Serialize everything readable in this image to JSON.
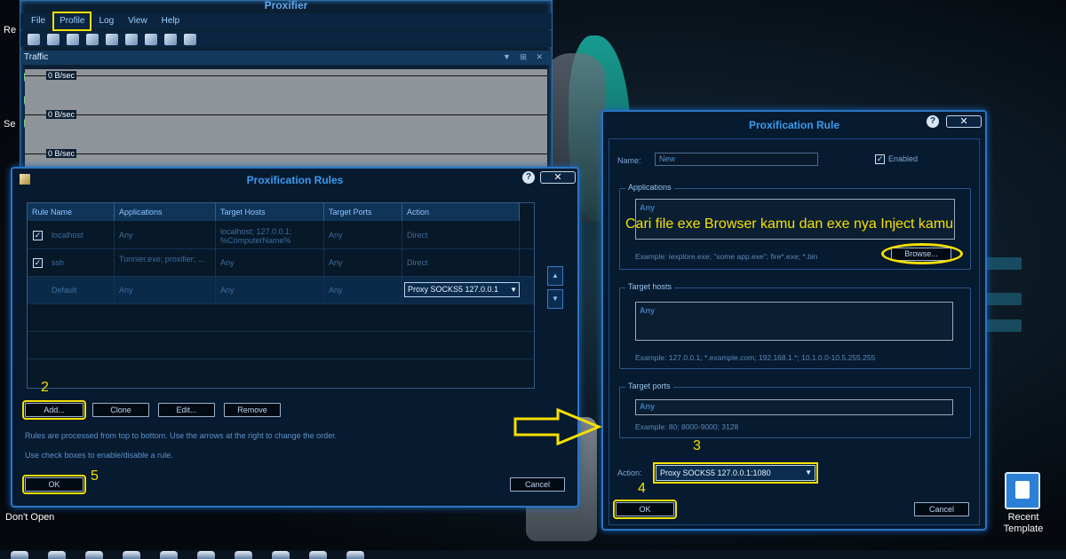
{
  "desktop": {
    "left_label_1": "Re",
    "left_label_2": "Se",
    "bottom_label": "Don't Open",
    "recent_template_line1": "Recent",
    "recent_template_line2": "Template"
  },
  "main_window": {
    "title": "Proxifier",
    "menu": [
      "File",
      "Profile",
      "Log",
      "View",
      "Help"
    ],
    "panel_title": "Traffic",
    "traffic_labels": [
      "0 B/sec",
      "0 B/sec",
      "0 B/sec"
    ]
  },
  "rules_dialog": {
    "title": "Proxification Rules",
    "help": "?",
    "close": "✕",
    "columns": [
      "Rule Name",
      "Applications",
      "Target Hosts",
      "Target Ports",
      "Action"
    ],
    "rows": [
      {
        "checked": true,
        "name": "localhost",
        "applications": "Any",
        "hosts": "localhost; 127.0.0.1; %ComputerName%",
        "ports": "Any",
        "action": "Direct"
      },
      {
        "checked": true,
        "name": "ssh",
        "applications": "Tunnier.exe; proxifier; ...",
        "hosts": "Any",
        "ports": "Any",
        "action": "Direct"
      },
      {
        "checked": false,
        "name": "Default",
        "applications": "Any",
        "hosts": "Any",
        "ports": "Any",
        "action": "Proxy SOCKS5 127.0.0.1"
      }
    ],
    "buttons": {
      "add": "Add...",
      "clone": "Clone",
      "edit": "Edit...",
      "remove": "Remove",
      "ok": "OK",
      "cancel": "Cancel"
    },
    "hint1": "Rules are processed from top to bottom. Use the arrows at the right to change the order.",
    "hint2": "Use check boxes to enable/disable a rule."
  },
  "rule_dialog": {
    "title": "Proxification Rule",
    "help": "?",
    "close": "✕",
    "name_label": "Name:",
    "name_value": "New",
    "enabled_label": "Enabled",
    "enabled": true,
    "applications_title": "Applications",
    "applications_value": "Any",
    "applications_example": "Example: iexplore.exe; \"some app.exe\"; fire*.exe; *.bin",
    "browse": "Browse...",
    "hosts_title": "Target hosts",
    "hosts_value": "Any",
    "hosts_example": "Example: 127.0.0.1; *.example.com; 192.168.1.*; 10.1.0.0-10.5.255.255",
    "ports_title": "Target ports",
    "ports_value": "Any",
    "ports_example": "Example: 80; 8000-9000; 3128",
    "action_label": "Action:",
    "action_value": "Proxy SOCKS5 127.0.0.1:1080",
    "ok": "OK",
    "cancel": "Cancel"
  },
  "annotations": {
    "step2": "2",
    "step3": "3",
    "step4": "4",
    "step5": "5",
    "instruction": "Cari file exe Browser kamu dan exe nya Inject kamu"
  },
  "colors": {
    "highlight": "#f5e000",
    "dialog_border": "#2b75c4",
    "title_blue": "#3b9cf0"
  }
}
